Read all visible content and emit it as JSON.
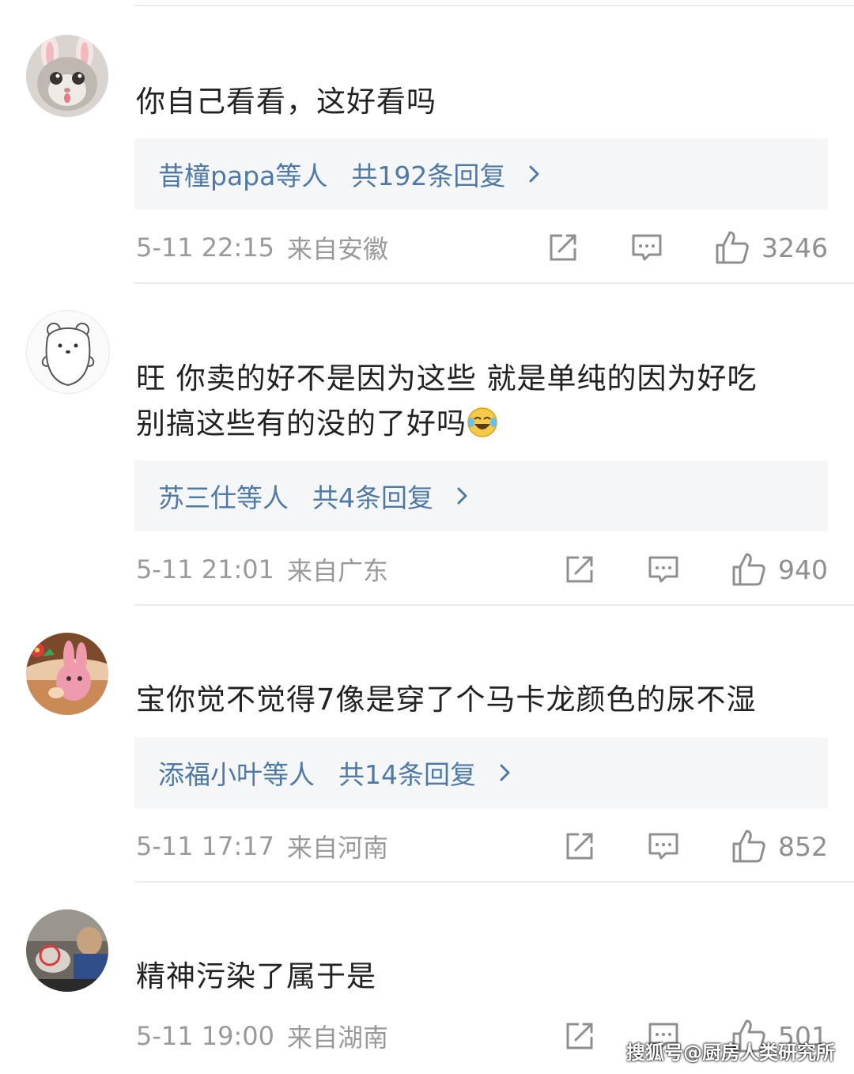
{
  "comments": [
    {
      "text": "你自己看看，这好看吗",
      "replies_who": "昔橦papa等人",
      "replies_count": "共192条回复",
      "time": "5-11 22:15",
      "location": "来自安徽",
      "likes": "3246",
      "avatar_icon": "bunny-ear-cat-avatar"
    },
    {
      "text_line1": "旺  你卖的好不是因为这些  就是单纯的因为好吃",
      "text_line2": "别搞这些有的没的了好吗",
      "emoji_icon": "laughing-tears-emoji",
      "replies_who": "苏三仕等人",
      "replies_count": "共4条回复",
      "time": "5-11 21:01",
      "location": "来自广东",
      "likes": "940",
      "avatar_icon": "white-bear-avatar"
    },
    {
      "text": "宝你觉不觉得7像是穿了个马卡龙颜色的尿不湿",
      "replies_who": "添福小叶等人",
      "replies_count": "共14条回复",
      "time": "5-11 17:17",
      "location": "来自河南",
      "likes": "852",
      "avatar_icon": "cartoon-pink-bunny-avatar"
    },
    {
      "text": "精神污染了属于是",
      "time": "5-11 19:00",
      "location": "来自湖南",
      "likes": "501",
      "avatar_icon": "photo-avatar"
    }
  ],
  "watermark": "搜狐号@厨房人类研究所",
  "colors": {
    "reply_link": "#4f7aa6",
    "meta_gray": "#9a9a9a",
    "reply_bg": "#f5f6f8",
    "text": "#222222"
  }
}
